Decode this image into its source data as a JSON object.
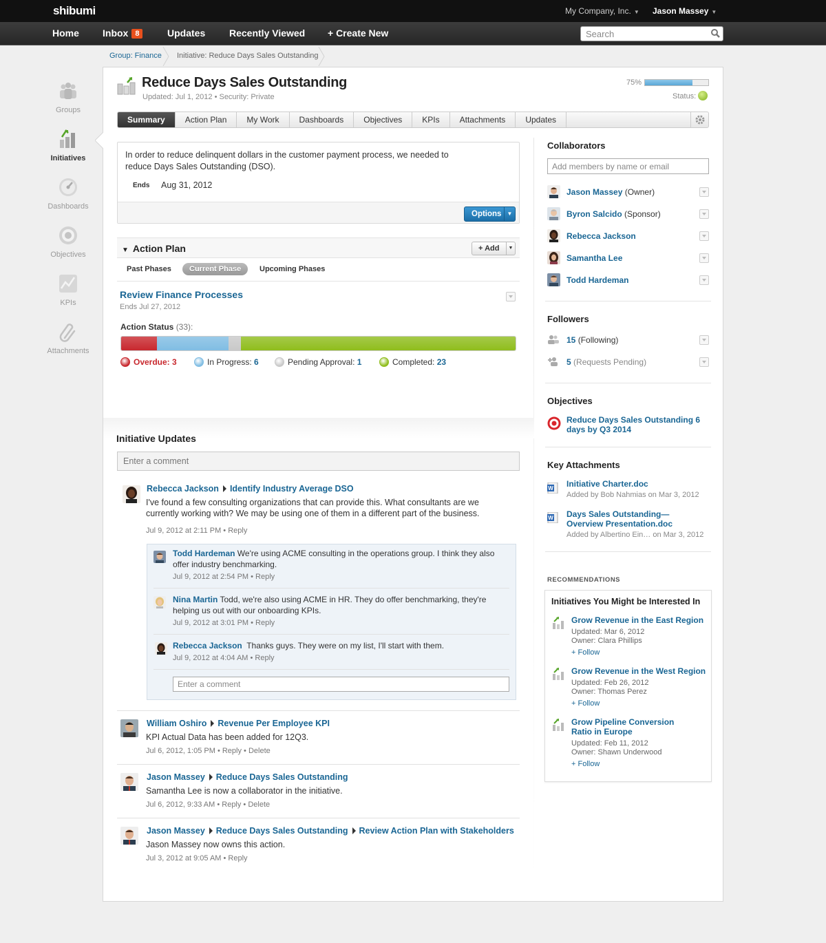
{
  "header": {
    "logo": "shibumi",
    "company": "My Company, Inc.",
    "user": "Jason Massey"
  },
  "nav": {
    "home": "Home",
    "inbox": "Inbox",
    "inbox_count": "8",
    "updates": "Updates",
    "recently_viewed": "Recently Viewed",
    "create_new": "+ Create New",
    "search_placeholder": "Search"
  },
  "breadcrumb": [
    "Group: Finance",
    "Initiative: Reduce Days Sales Outstanding"
  ],
  "sidebar": [
    {
      "label": "Groups",
      "icon": "groups-icon"
    },
    {
      "label": "Initiatives",
      "icon": "initiatives-icon"
    },
    {
      "label": "Dashboards",
      "icon": "dashboards-icon"
    },
    {
      "label": "Objectives",
      "icon": "objectives-icon"
    },
    {
      "label": "KPIs",
      "icon": "kpis-icon"
    },
    {
      "label": "Attachments",
      "icon": "paperclip-icon"
    }
  ],
  "initiative": {
    "title": "Reduce Days Sales Outstanding",
    "meta": "Updated: Jul 1, 2012  •  Security: Private",
    "progress_label": "75%",
    "progress": 0.75,
    "status_label": "Status:",
    "status_color": "#7fb01b"
  },
  "tabs": [
    "Summary",
    "Action Plan",
    "My Work",
    "Dashboards",
    "Objectives",
    "KPIs",
    "Attachments",
    "Updates"
  ],
  "summary": {
    "text": "In order to reduce delinquent dollars in the customer payment process, we needed to reduce Days Sales Outstanding (DSO).",
    "ends_label": "Ends",
    "ends_value": "Aug 31, 2012",
    "options_label": "Options"
  },
  "action_plan": {
    "title": "Action Plan",
    "add_label": "+ Add",
    "phases": [
      "Past Phases",
      "Current Phase",
      "Upcoming Phases"
    ],
    "phase_name": "Review Finance Processes",
    "phase_ends": "Ends Jul 27, 2012",
    "status_label": "Action Status",
    "status_total": "(33):",
    "statuses": [
      {
        "label": "Overdue:",
        "count": 3,
        "color": "#c8282e"
      },
      {
        "label": "In Progress:",
        "count": 6,
        "color": "#80bde3"
      },
      {
        "label": "Pending Approval:",
        "count": 1,
        "color": "#c9c9c9"
      },
      {
        "label": "Completed:",
        "count": 23,
        "color": "#8fbd1c"
      }
    ]
  },
  "updates": {
    "title": "Initiative Updates",
    "comment_placeholder": "Enter a comment",
    "items": [
      {
        "author": "Rebecca Jackson",
        "targets": [
          "Identify Industry Average DSO"
        ],
        "text": "I've found a few consulting organizations that can provide this. What consultants are we currently working with? We may be using one of them in a different part of the business.",
        "meta": "Jul 9, 2012 at 2:11 PM  •  Reply"
      },
      {
        "author": "William Oshiro",
        "targets": [
          "Revenue Per Employee KPI"
        ],
        "text": "KPI Actual Data has been added for 12Q3.",
        "meta": "Jul 6, 2012, 1:05 PM  •  Reply  •  Delete"
      },
      {
        "author": "Jason Massey",
        "targets": [
          "Reduce Days Sales Outstanding"
        ],
        "text": "Samantha Lee is now a collaborator in the initiative.",
        "meta": "Jul 6, 2012, 9:33 AM  •  Reply  •  Delete"
      },
      {
        "author": "Jason Massey",
        "targets": [
          "Reduce Days Sales Outstanding",
          "Review Action Plan with Stakeholders"
        ],
        "text": "Jason Massey now owns this action.",
        "meta": "Jul 3, 2012 at 9:05 AM  •  Reply"
      }
    ],
    "replies": [
      {
        "author": "Todd Hardeman",
        "text": "We're using ACME consulting in the operations group. I think they also offer industry benchmarking.",
        "meta": "Jul 9, 2012 at 2:54 PM  •  Reply"
      },
      {
        "author": "Nina Martin",
        "text": "Todd, we're also using ACME in HR. They do offer benchmarking, they're helping us out with our onboarding KPIs.",
        "meta": "Jul 9, 2012 at 3:01 PM  •  Reply"
      },
      {
        "author": "Rebecca Jackson",
        "text": "Thanks guys. They were on my list, I'll start with them.",
        "meta": "Jul 9, 2012 at 4:04 AM  •  Reply"
      }
    ],
    "reply_placeholder": "Enter a comment"
  },
  "collaborators": {
    "title": "Collaborators",
    "placeholder": "Add members by name or email",
    "people": [
      {
        "name": "Jason Massey",
        "role": "(Owner)"
      },
      {
        "name": "Byron Salcido",
        "role": "(Sponsor)"
      },
      {
        "name": "Rebecca Jackson",
        "role": ""
      },
      {
        "name": "Samantha Lee",
        "role": ""
      },
      {
        "name": "Todd Hardeman",
        "role": ""
      }
    ]
  },
  "followers": {
    "title": "Followers",
    "following_count": "15",
    "following_label": "(Following)",
    "pending_count": "5",
    "pending_label": "(Requests Pending)"
  },
  "objectives": {
    "title": "Objectives",
    "items": [
      "Reduce Days Sales Outstanding 6 days by Q3 2014"
    ]
  },
  "attachments": {
    "title": "Key Attachments",
    "items": [
      {
        "name": "Initiative Charter.doc",
        "meta": "Added by Bob Nahmias on Mar 3, 2012"
      },
      {
        "name": "Days Sales Outstanding—Overview Presentation.doc",
        "meta": "Added by Albertino Ein… on Mar 3, 2012"
      }
    ]
  },
  "recommendations": {
    "label": "RECOMMENDATIONS",
    "title": "Initiatives You Might be Interested In",
    "follow_label": "+ Follow",
    "items": [
      {
        "name": "Grow Revenue in the East Region",
        "updated": "Updated: Mar 6, 2012",
        "owner": "Owner: Clara Phillips"
      },
      {
        "name": "Grow Revenue in the West Region",
        "updated": "Updated: Feb 26, 2012",
        "owner": "Owner: Thomas Perez"
      },
      {
        "name": "Grow Pipeline Conversion Ratio in Europe",
        "updated": "Updated: Feb 11, 2012",
        "owner": "Owner: Shawn Underwood"
      }
    ]
  }
}
